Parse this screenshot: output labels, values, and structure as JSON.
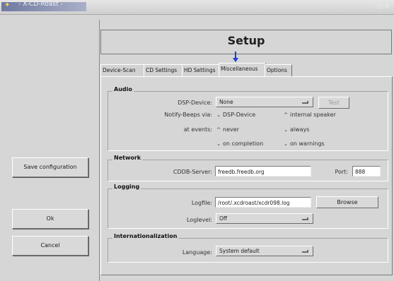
{
  "window": {
    "title": "- X-CD-Roast -",
    "right_text": "- □ ×"
  },
  "sidebar": {
    "save_label": "Save configuration",
    "ok_label": "Ok",
    "cancel_label": "Cancel"
  },
  "header": {
    "title": "Setup"
  },
  "tabs": [
    {
      "label": "Device-Scan",
      "active": false
    },
    {
      "label": "CD Settings",
      "active": false
    },
    {
      "label": "HD Settings",
      "active": false
    },
    {
      "label": "Miscellaneous",
      "active": true
    },
    {
      "label": "Options",
      "active": false
    }
  ],
  "audio": {
    "group_label": "Audio",
    "dsp_label": "DSP-Device:",
    "dsp_value": "None",
    "test_label": "Test",
    "notify_label": "Notify-Beeps via:",
    "notify_options": [
      "DSP-Device",
      "internal speaker"
    ],
    "events_label": "at events:",
    "event_options": [
      "never",
      "always",
      "on completion",
      "on warnings"
    ]
  },
  "network": {
    "group_label": "Network",
    "cddb_label": "CDDB-Server:",
    "cddb_value": "freedb.freedb.org",
    "port_label": "Port:",
    "port_value": "888"
  },
  "logging": {
    "group_label": "Logging",
    "logfile_label": "Logfile:",
    "logfile_value": "/root/.xcdroast/xcdr098.log",
    "browse_label": "Browse",
    "loglevel_label": "Loglevel:",
    "loglevel_value": "Off"
  },
  "intl": {
    "group_label": "Internationalization",
    "language_label": "Language:",
    "language_value": "System default"
  }
}
